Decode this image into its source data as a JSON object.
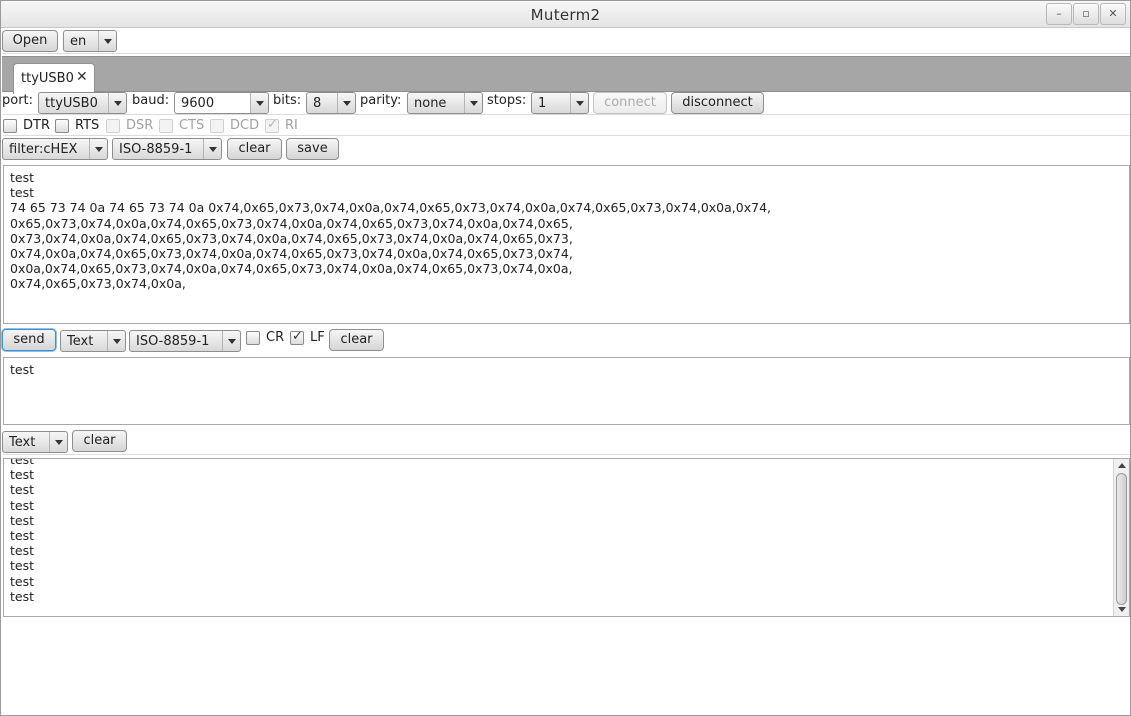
{
  "window": {
    "title": "Muterm2",
    "minimize": "–",
    "maximize": "▫",
    "close": "✕"
  },
  "toolbar": {
    "open_label": "Open",
    "language": "en"
  },
  "tab": {
    "label": "ttyUSB0",
    "close": "✕"
  },
  "port_settings": {
    "port_label": "port:",
    "port_value": "ttyUSB0",
    "baud_label": "baud:",
    "baud_value": "9600",
    "bits_label": "bits:",
    "bits_value": "8",
    "parity_label": "parity:",
    "parity_value": "none",
    "stops_label": "stops:",
    "stops_value": "1",
    "connect_label": "connect",
    "disconnect_label": "disconnect"
  },
  "signals": {
    "dtr": {
      "label": "DTR",
      "checked": false
    },
    "rts": {
      "label": "RTS",
      "checked": false
    },
    "dsr": {
      "label": "DSR",
      "checked": false
    },
    "cts": {
      "label": "CTS",
      "checked": false
    },
    "dcd": {
      "label": "DCD",
      "checked": false
    },
    "ri": {
      "label": "RI",
      "checked": true
    }
  },
  "receive": {
    "filter_value": "filter:cHEX",
    "encoding_value": "ISO-8859-1",
    "clear_label": "clear",
    "save_label": "save",
    "text": "test\ntest\n74 65 73 74 0a 74 65 73 74 0a 0x74,0x65,0x73,0x74,0x0a,0x74,0x65,0x73,0x74,0x0a,0x74,0x65,0x73,0x74,0x0a,0x74,\n0x65,0x73,0x74,0x0a,0x74,0x65,0x73,0x74,0x0a,0x74,0x65,0x73,0x74,0x0a,0x74,0x65,\n0x73,0x74,0x0a,0x74,0x65,0x73,0x74,0x0a,0x74,0x65,0x73,0x74,0x0a,0x74,0x65,0x73,\n0x74,0x0a,0x74,0x65,0x73,0x74,0x0a,0x74,0x65,0x73,0x74,0x0a,0x74,0x65,0x73,0x74,\n0x0a,0x74,0x65,0x73,0x74,0x0a,0x74,0x65,0x73,0x74,0x0a,0x74,0x65,0x73,0x74,0x0a,\n0x74,0x65,0x73,0x74,0x0a,"
  },
  "send": {
    "send_label": "send",
    "mode_value": "Text",
    "encoding_value": "ISO-8859-1",
    "cr": {
      "label": "CR",
      "checked": false
    },
    "lf": {
      "label": "LF",
      "checked": true
    },
    "clear_label": "clear",
    "text": "test"
  },
  "history": {
    "mode_value": "Text",
    "clear_label": "clear",
    "lines": "test\ntest\ntest\ntest\ntest\ntest\ntest\ntest\ntest\ntest"
  }
}
